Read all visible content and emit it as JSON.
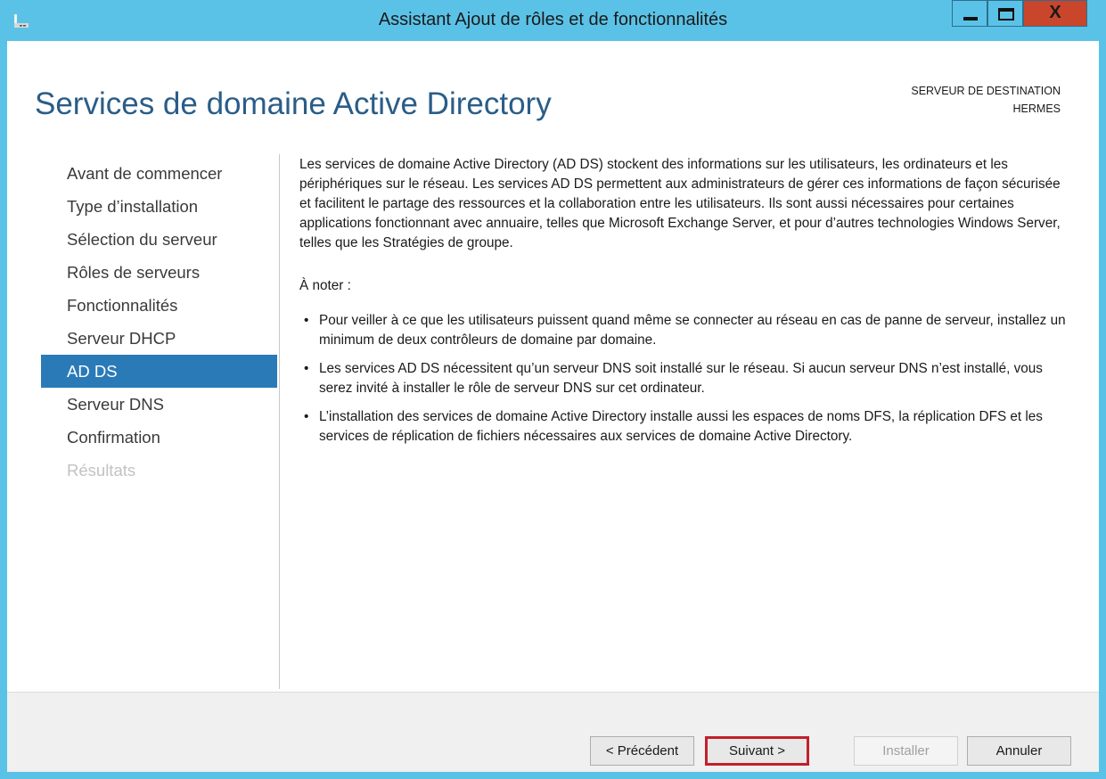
{
  "window": {
    "title": "Assistant Ajout de rôles et de fonctionnalités",
    "controls": {
      "minimize": "minimize",
      "maximize": "maximize",
      "close": "X"
    },
    "icon": "server-manager-icon"
  },
  "header": {
    "page_title": "Services de domaine Active Directory",
    "destination_label": "SERVEUR DE DESTINATION",
    "destination_server": "HERMES"
  },
  "sidebar": {
    "items": [
      {
        "label": "Avant de commencer",
        "state": "normal"
      },
      {
        "label": "Type d’installation",
        "state": "normal"
      },
      {
        "label": "Sélection du serveur",
        "state": "normal"
      },
      {
        "label": "Rôles de serveurs",
        "state": "normal"
      },
      {
        "label": "Fonctionnalités",
        "state": "normal"
      },
      {
        "label": "Serveur DHCP",
        "state": "normal"
      },
      {
        "label": "AD DS",
        "state": "active"
      },
      {
        "label": "Serveur DNS",
        "state": "normal"
      },
      {
        "label": "Confirmation",
        "state": "normal"
      },
      {
        "label": "Résultats",
        "state": "disabled"
      }
    ]
  },
  "main": {
    "intro": "Les services de domaine Active Directory (AD DS) stockent des informations sur les utilisateurs, les ordinateurs et les périphériques sur le réseau. Les services AD DS permettent aux administrateurs de gérer ces informations de façon sécurisée et facilitent le partage des ressources et la collaboration entre les utilisateurs. Ils sont aussi nécessaires pour certaines applications fonctionnant avec annuaire, telles que Microsoft Exchange Server, et pour d’autres technologies Windows Server, telles que les Stratégies de groupe.",
    "note_label": "À noter :",
    "bullets": [
      "Pour veiller à ce que les utilisateurs puissent quand même se connecter au réseau en cas de panne de serveur, installez un minimum de deux contrôleurs de domaine par domaine.",
      "Les services AD DS nécessitent qu’un serveur DNS soit installé sur le réseau. Si aucun serveur DNS n’est installé, vous serez invité à installer le rôle de serveur DNS sur cet ordinateur.",
      "L’installation des services de domaine Active Directory installe aussi les espaces de noms DFS, la réplication DFS et les services de réplication de fichiers nécessaires aux services de domaine Active Directory."
    ]
  },
  "footer": {
    "prev_label": "< Précédent",
    "next_label": "Suivant >",
    "install_label": "Installer",
    "cancel_label": "Annuler"
  },
  "colors": {
    "titlebar": "#5bc2e7",
    "accent": "#2a7ab8",
    "title_text": "#2a5d88",
    "close_button": "#c9462c",
    "highlight_box": "#c2202a"
  }
}
